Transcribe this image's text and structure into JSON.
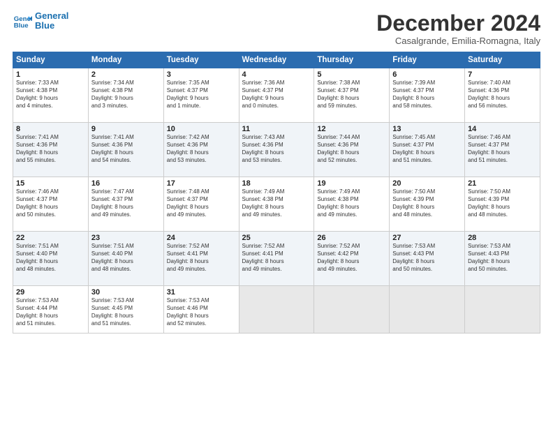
{
  "logo": {
    "line1": "General",
    "line2": "Blue"
  },
  "title": "December 2024",
  "subtitle": "Casalgrande, Emilia-Romagna, Italy",
  "header_days": [
    "Sunday",
    "Monday",
    "Tuesday",
    "Wednesday",
    "Thursday",
    "Friday",
    "Saturday"
  ],
  "weeks": [
    [
      {
        "day": "1",
        "info": "Sunrise: 7:33 AM\nSunset: 4:38 PM\nDaylight: 9 hours\nand 4 minutes."
      },
      {
        "day": "2",
        "info": "Sunrise: 7:34 AM\nSunset: 4:38 PM\nDaylight: 9 hours\nand 3 minutes."
      },
      {
        "day": "3",
        "info": "Sunrise: 7:35 AM\nSunset: 4:37 PM\nDaylight: 9 hours\nand 1 minute."
      },
      {
        "day": "4",
        "info": "Sunrise: 7:36 AM\nSunset: 4:37 PM\nDaylight: 9 hours\nand 0 minutes."
      },
      {
        "day": "5",
        "info": "Sunrise: 7:38 AM\nSunset: 4:37 PM\nDaylight: 8 hours\nand 59 minutes."
      },
      {
        "day": "6",
        "info": "Sunrise: 7:39 AM\nSunset: 4:37 PM\nDaylight: 8 hours\nand 58 minutes."
      },
      {
        "day": "7",
        "info": "Sunrise: 7:40 AM\nSunset: 4:36 PM\nDaylight: 8 hours\nand 56 minutes."
      }
    ],
    [
      {
        "day": "8",
        "info": "Sunrise: 7:41 AM\nSunset: 4:36 PM\nDaylight: 8 hours\nand 55 minutes."
      },
      {
        "day": "9",
        "info": "Sunrise: 7:41 AM\nSunset: 4:36 PM\nDaylight: 8 hours\nand 54 minutes."
      },
      {
        "day": "10",
        "info": "Sunrise: 7:42 AM\nSunset: 4:36 PM\nDaylight: 8 hours\nand 53 minutes."
      },
      {
        "day": "11",
        "info": "Sunrise: 7:43 AM\nSunset: 4:36 PM\nDaylight: 8 hours\nand 53 minutes."
      },
      {
        "day": "12",
        "info": "Sunrise: 7:44 AM\nSunset: 4:36 PM\nDaylight: 8 hours\nand 52 minutes."
      },
      {
        "day": "13",
        "info": "Sunrise: 7:45 AM\nSunset: 4:37 PM\nDaylight: 8 hours\nand 51 minutes."
      },
      {
        "day": "14",
        "info": "Sunrise: 7:46 AM\nSunset: 4:37 PM\nDaylight: 8 hours\nand 51 minutes."
      }
    ],
    [
      {
        "day": "15",
        "info": "Sunrise: 7:46 AM\nSunset: 4:37 PM\nDaylight: 8 hours\nand 50 minutes."
      },
      {
        "day": "16",
        "info": "Sunrise: 7:47 AM\nSunset: 4:37 PM\nDaylight: 8 hours\nand 49 minutes."
      },
      {
        "day": "17",
        "info": "Sunrise: 7:48 AM\nSunset: 4:37 PM\nDaylight: 8 hours\nand 49 minutes."
      },
      {
        "day": "18",
        "info": "Sunrise: 7:49 AM\nSunset: 4:38 PM\nDaylight: 8 hours\nand 49 minutes."
      },
      {
        "day": "19",
        "info": "Sunrise: 7:49 AM\nSunset: 4:38 PM\nDaylight: 8 hours\nand 49 minutes."
      },
      {
        "day": "20",
        "info": "Sunrise: 7:50 AM\nSunset: 4:39 PM\nDaylight: 8 hours\nand 48 minutes."
      },
      {
        "day": "21",
        "info": "Sunrise: 7:50 AM\nSunset: 4:39 PM\nDaylight: 8 hours\nand 48 minutes."
      }
    ],
    [
      {
        "day": "22",
        "info": "Sunrise: 7:51 AM\nSunset: 4:40 PM\nDaylight: 8 hours\nand 48 minutes."
      },
      {
        "day": "23",
        "info": "Sunrise: 7:51 AM\nSunset: 4:40 PM\nDaylight: 8 hours\nand 48 minutes."
      },
      {
        "day": "24",
        "info": "Sunrise: 7:52 AM\nSunset: 4:41 PM\nDaylight: 8 hours\nand 49 minutes."
      },
      {
        "day": "25",
        "info": "Sunrise: 7:52 AM\nSunset: 4:41 PM\nDaylight: 8 hours\nand 49 minutes."
      },
      {
        "day": "26",
        "info": "Sunrise: 7:52 AM\nSunset: 4:42 PM\nDaylight: 8 hours\nand 49 minutes."
      },
      {
        "day": "27",
        "info": "Sunrise: 7:53 AM\nSunset: 4:43 PM\nDaylight: 8 hours\nand 50 minutes."
      },
      {
        "day": "28",
        "info": "Sunrise: 7:53 AM\nSunset: 4:43 PM\nDaylight: 8 hours\nand 50 minutes."
      }
    ],
    [
      {
        "day": "29",
        "info": "Sunrise: 7:53 AM\nSunset: 4:44 PM\nDaylight: 8 hours\nand 51 minutes."
      },
      {
        "day": "30",
        "info": "Sunrise: 7:53 AM\nSunset: 4:45 PM\nDaylight: 8 hours\nand 51 minutes."
      },
      {
        "day": "31",
        "info": "Sunrise: 7:53 AM\nSunset: 4:46 PM\nDaylight: 8 hours\nand 52 minutes."
      },
      {
        "day": "",
        "info": ""
      },
      {
        "day": "",
        "info": ""
      },
      {
        "day": "",
        "info": ""
      },
      {
        "day": "",
        "info": ""
      }
    ]
  ]
}
